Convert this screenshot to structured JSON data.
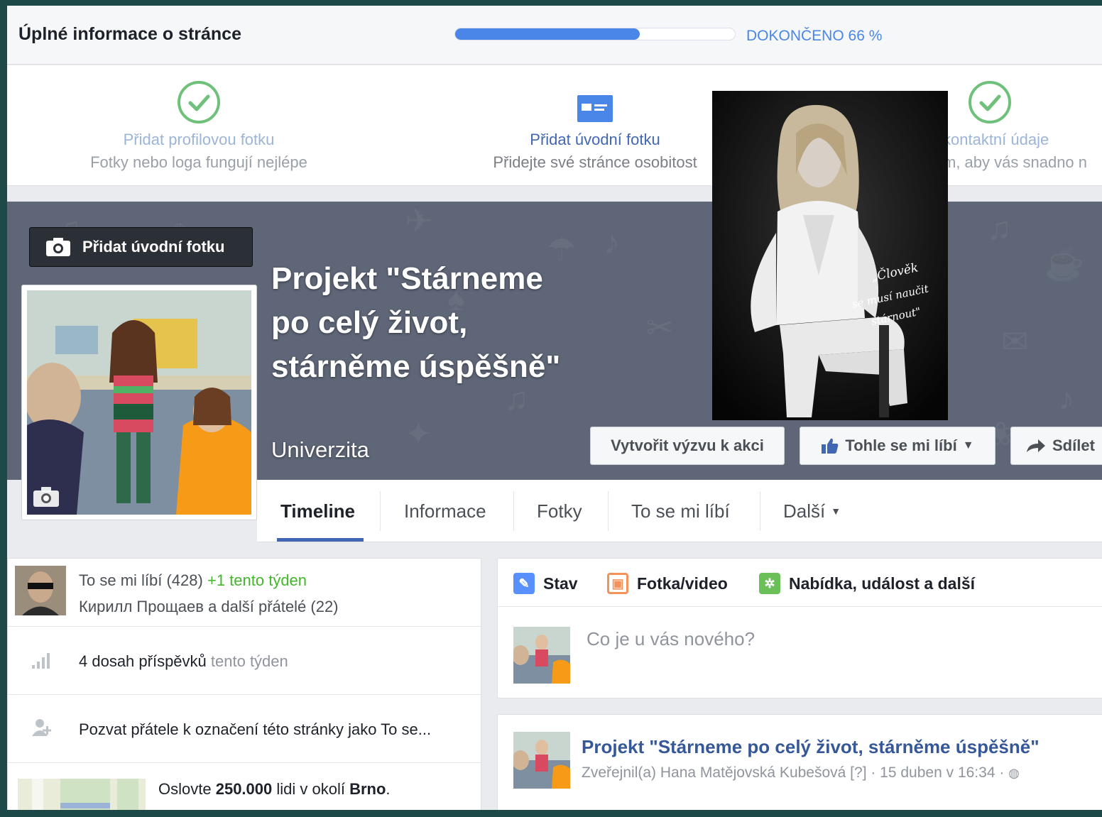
{
  "banner": {
    "title": "Úplné informace o stránce",
    "progress_percent": 66,
    "progress_text": "DOKONČENO 66 %"
  },
  "steps": [
    {
      "title": "Přidat profilovou fotku",
      "subtitle": "Fotky nebo loga fungují nejlépe",
      "icon": "check-circle-icon"
    },
    {
      "title": "Přidat úvodní fotku",
      "subtitle": "Přidejte své stránce osobitost",
      "icon": "cover-photo-icon"
    },
    {
      "title": "kontaktní údaje",
      "subtitle": "m, aby vás snadno n",
      "icon": "check-circle-icon"
    }
  ],
  "cover": {
    "add_cover_label": "Přidat úvodní fotku",
    "page_name": "Projekt \"Stárneme po celý život, stárněme úspěšně\"",
    "category": "Univerzita",
    "portrait_caption": "„Člověk se musí naučit stárnout\""
  },
  "actions": {
    "cta": "Vytvořit výzvu k akci",
    "like": "Tohle se mi líbí",
    "share": "Sdílet"
  },
  "tabs": [
    "Timeline",
    "Informace",
    "Fotky",
    "To se mi líbí",
    "Další"
  ],
  "left": {
    "likes_text": "To se mi líbí (428)",
    "likes_delta": "+1 tento týden",
    "likes_friends": "Кирилл Прощаев a další přátelé (22)",
    "reach_value": "4 dosah příspěvků",
    "reach_period": "tento týden",
    "invite": "Pozvat přátele k označení této stránky jako To se...",
    "promo_prefix": "Oslovte",
    "promo_count": "250.000",
    "promo_mid": "lidi v okolí",
    "promo_city": "Brno",
    "promo_end": "."
  },
  "composer": {
    "tab_status": "Stav",
    "tab_photo": "Fotka/video",
    "tab_offer": "Nabídka, událost a další",
    "placeholder": "Co je u vás nového?"
  },
  "post": {
    "title": "Projekt \"Stárneme po celý život, stárněme úspěšně\"",
    "meta": "Zveřejnil(a) Hana Matějovská Kubešová [?] · 15 duben v 16:34 ·"
  },
  "colors": {
    "fb_blue": "#4267b2",
    "progress": "#4a86e8",
    "cover": "#5e6677",
    "green": "#42b72a"
  }
}
